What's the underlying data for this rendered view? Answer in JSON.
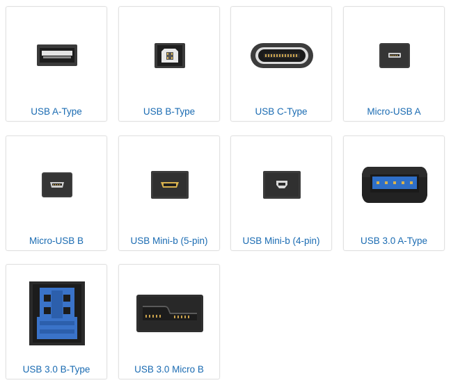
{
  "connectors": [
    {
      "label": "USB A-Type",
      "icon": "usb-a-connector-icon"
    },
    {
      "label": "USB B-Type",
      "icon": "usb-b-connector-icon"
    },
    {
      "label": "USB C-Type",
      "icon": "usb-c-connector-icon"
    },
    {
      "label": "Micro-USB A",
      "icon": "micro-usb-a-connector-icon"
    },
    {
      "label": "Micro-USB B",
      "icon": "micro-usb-b-connector-icon"
    },
    {
      "label": "USB Mini-b (5-pin)",
      "icon": "usb-mini-b-5pin-connector-icon"
    },
    {
      "label": "USB Mini-b (4-pin)",
      "icon": "usb-mini-b-4pin-connector-icon"
    },
    {
      "label": "USB 3.0 A-Type",
      "icon": "usb-3-a-connector-icon"
    },
    {
      "label": "USB 3.0 B-Type",
      "icon": "usb-3-b-connector-icon"
    },
    {
      "label": "USB 3.0 Micro B",
      "icon": "usb-3-micro-b-connector-icon"
    }
  ],
  "colors": {
    "label_text": "#1a6bb2",
    "card_border": "#e1e1e1",
    "connector_dark": "#333333",
    "usb3_blue": "#2f6fc8"
  }
}
